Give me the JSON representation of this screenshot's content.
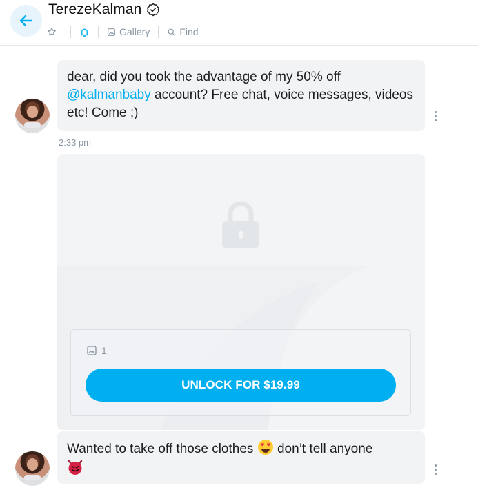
{
  "header": {
    "title": "TerezeKalman",
    "back_icon": "arrow-left-icon",
    "verified_icon": "verified-badge-icon",
    "toolbar": {
      "star_icon": "star-icon",
      "bell_icon": "bell-icon",
      "gallery_label": "Gallery",
      "find_label": "Find"
    }
  },
  "messages": [
    {
      "text_before": "dear, did you took the advantage of my 50% off ",
      "mention": "@kalmanbaby",
      "text_after": " account? Free chat, voice messages, videos etc! Come ;)",
      "time": "2:33 pm"
    },
    {
      "text": "Wanted to take off those clothes",
      "text_after": " don’t tell anyone"
    }
  ],
  "locked_media": {
    "media_count": "1",
    "unlock_label": "UNLOCK FOR $19.99"
  },
  "colors": {
    "accent": "#00aff0",
    "bubble": "#f2f3f5",
    "muted": "#8a96a3"
  }
}
